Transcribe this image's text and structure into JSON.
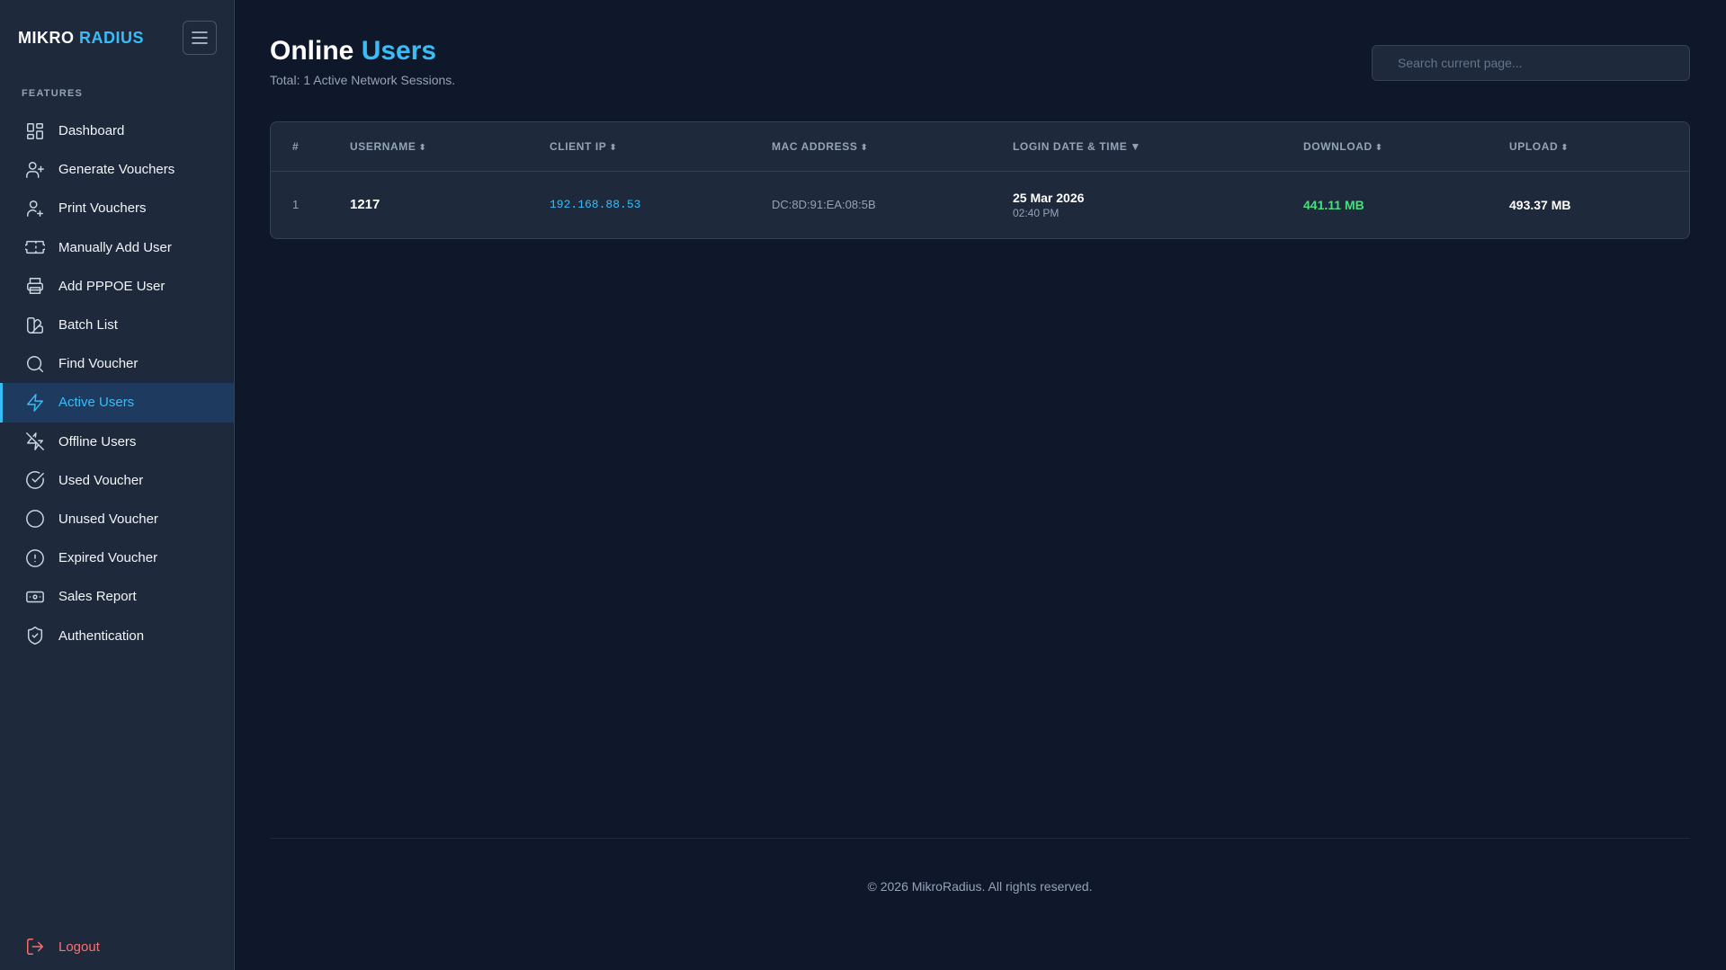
{
  "brand": {
    "part1": "MIKRO",
    "part2": "RADIUS"
  },
  "sidebar": {
    "section_label": "FEATURES",
    "items": [
      {
        "label": "Dashboard",
        "icon": "dashboard-icon",
        "active": false
      },
      {
        "label": "Generate Vouchers",
        "icon": "user-plus-icon",
        "active": false
      },
      {
        "label": "Print Vouchers",
        "icon": "user-add-icon",
        "active": false
      },
      {
        "label": "Manually Add User",
        "icon": "ticket-icon",
        "active": false
      },
      {
        "label": "Add PPPOE User",
        "icon": "printer-icon",
        "active": false
      },
      {
        "label": "Batch List",
        "icon": "swatch-book-icon",
        "active": false
      },
      {
        "label": "Find Voucher",
        "icon": "search-icon",
        "active": false
      },
      {
        "label": "Active Users",
        "icon": "zap-icon",
        "active": true
      },
      {
        "label": "Offline Users",
        "icon": "zap-off-icon",
        "active": false
      },
      {
        "label": "Used Voucher",
        "icon": "check-circle-icon",
        "active": false
      },
      {
        "label": "Unused Voucher",
        "icon": "circle-icon",
        "active": false
      },
      {
        "label": "Expired Voucher",
        "icon": "alert-circle-icon",
        "active": false
      },
      {
        "label": "Sales Report",
        "icon": "banknote-icon",
        "active": false
      },
      {
        "label": "Authentication",
        "icon": "shield-check-icon",
        "active": false
      }
    ],
    "logout_label": "Logout"
  },
  "header": {
    "title_part1": "Online",
    "title_part2": "Users",
    "subtitle": "Total: 1 Active Network Sessions.",
    "search_placeholder": "Search current page..."
  },
  "table": {
    "columns": [
      {
        "label": "#",
        "sort": ""
      },
      {
        "label": "USERNAME",
        "sort": "⬍"
      },
      {
        "label": "CLIENT IP",
        "sort": "⬍"
      },
      {
        "label": "MAC ADDRESS",
        "sort": "⬍"
      },
      {
        "label": "LOGIN DATE & TIME",
        "sort": "▼"
      },
      {
        "label": "DOWNLOAD",
        "sort": "⬍"
      },
      {
        "label": "UPLOAD",
        "sort": "⬍"
      }
    ],
    "rows": [
      {
        "index": "1",
        "username": "1217",
        "client_ip": "192.168.88.53",
        "mac": "DC:8D:91:EA:08:5B",
        "login_date": "25 Mar 2026",
        "login_time": "02:40 PM",
        "download": "441.11 MB",
        "upload": "493.37 MB"
      }
    ]
  },
  "footer": {
    "text": "© 2026 MikroRadius. All rights reserved."
  },
  "colors": {
    "background": "#0f172a",
    "sidebar": "#1e293b",
    "accent": "#38bdf8",
    "download": "#4ade80",
    "logout": "#f87171"
  }
}
